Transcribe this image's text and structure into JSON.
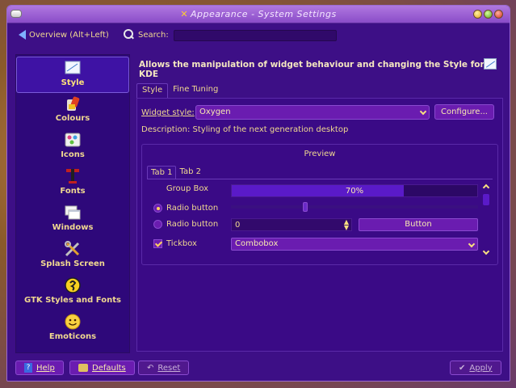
{
  "window": {
    "title": "Appearance - System Settings"
  },
  "toolbar": {
    "overview_label": "Overview (Alt+Left)",
    "search_label": "Search:",
    "search_value": ""
  },
  "sidebar": {
    "items": [
      {
        "label": "Style",
        "icon": "style-icon",
        "active": true
      },
      {
        "label": "Colours",
        "icon": "colours-icon"
      },
      {
        "label": "Icons",
        "icon": "icons-icon"
      },
      {
        "label": "Fonts",
        "icon": "fonts-icon"
      },
      {
        "label": "Windows",
        "icon": "windows-icon"
      },
      {
        "label": "Splash Screen",
        "icon": "splash-screen-icon"
      },
      {
        "label": "GTK Styles and Fonts",
        "icon": "gtk-icon"
      },
      {
        "label": "Emoticons",
        "icon": "emoticons-icon"
      }
    ]
  },
  "main": {
    "description": "Allows the manipulation of widget behaviour and changing the Style for KDE",
    "tabs": [
      {
        "label": "Style",
        "active": true
      },
      {
        "label": "Fine Tuning"
      }
    ],
    "widget_style_label": "Widget style:",
    "widget_style_value": "Oxygen",
    "configure_label": "Configure...",
    "style_description": "Description: Styling of the next generation desktop",
    "preview": {
      "title": "Preview",
      "tabs": [
        {
          "label": "Tab 1",
          "active": true
        },
        {
          "label": "Tab 2"
        }
      ],
      "group_box_title": "Group Box",
      "radio1_label": "Radio button",
      "radio2_label": "Radio button",
      "tickbox_label": "Tickbox",
      "progress_text": "70%",
      "progress_value": 0.7,
      "slider_value": 0.3,
      "spin_value": "0",
      "button_label": "Button",
      "combobox_value": "Combobox"
    }
  },
  "bottom": {
    "help_label": "Help",
    "defaults_label": "Defaults",
    "reset_label": "Reset",
    "apply_label": "Apply"
  },
  "colors": {
    "accent": "#3d0f86",
    "text": "#f0d890"
  }
}
